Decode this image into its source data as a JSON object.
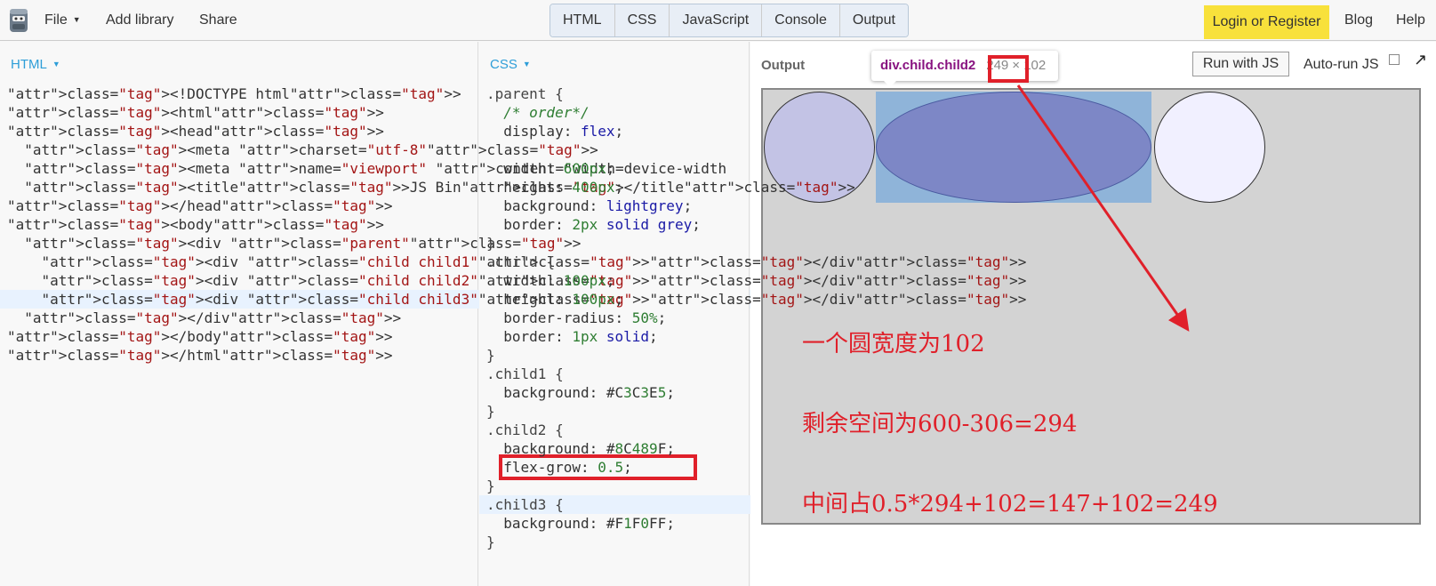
{
  "topbar": {
    "menu": [
      {
        "label": "File"
      },
      {
        "label": "Add library"
      },
      {
        "label": "Share"
      }
    ],
    "tabs": [
      "HTML",
      "CSS",
      "JavaScript",
      "Console",
      "Output"
    ],
    "login_label": "Login or Register",
    "blog_label": "Blog",
    "help_label": "Help"
  },
  "html_panel": {
    "label": "HTML",
    "lines": [
      "<!DOCTYPE html>",
      "<html>",
      "<head>",
      "  <meta charset=\"utf-8\">",
      "  <meta name=\"viewport\" content=\"width=device-width",
      "  <title>JS Bin</title>",
      "</head>",
      "<body>",
      "  <div class=\"parent\">",
      "    <div class=\"child child1\"></div>",
      "    <div class=\"child child2\"></div>",
      "    <div class=\"child child3\"></div>",
      "  </div>",
      "</body>",
      "</html>"
    ]
  },
  "css_panel": {
    "label": "CSS",
    "lines": [
      ".parent {",
      "  /* order*/",
      "  display: flex;",
      "",
      "  width: 600px;",
      "  height: 400px;",
      "  background: lightgrey;",
      "  border: 2px solid grey;",
      "}",
      ".child {",
      "  width: 100px;",
      "  height: 100px;",
      "  border-radius: 50%;",
      "  border: 1px solid;",
      "}",
      ".child1 {",
      "  background: #C3C3E5;",
      "}",
      ".child2 {",
      "  background: #8C489F;",
      "  flex-grow: 0.5;",
      "}",
      ".child3 {",
      "  background: #F1F0FF;",
      "}"
    ]
  },
  "output_panel": {
    "label": "Output",
    "run_label": "Run with JS",
    "autorun_label": "Auto-run JS",
    "autorun_checked": false,
    "tooltip_selector": "div.child.child2",
    "tooltip_width": "249",
    "tooltip_height": "× 102",
    "annotation": [
      "一个圆宽度为102",
      "剩余空间为600-306=294",
      "中间占0.5*294+102=147+102=249"
    ]
  },
  "colors": {
    "child1": "#C3C3E5",
    "child2_rendered": "#7D87C6",
    "child3": "#F1F0FF",
    "annotation_red": "#E0202A",
    "login_bg": "#F8E13B"
  }
}
